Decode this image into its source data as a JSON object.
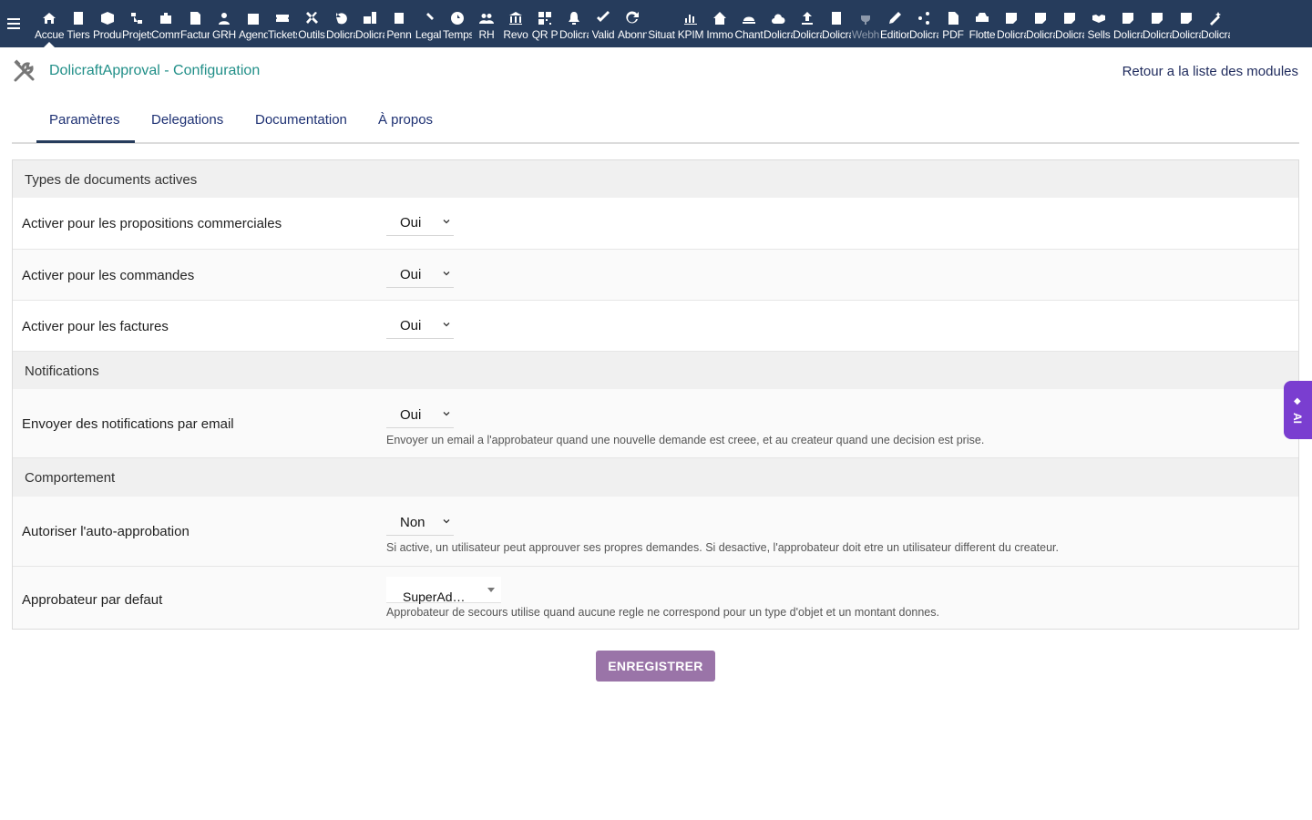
{
  "nav": {
    "items": [
      {
        "label": "Accueil",
        "icon": "home-icon"
      },
      {
        "label": "Tiers",
        "icon": "building-icon"
      },
      {
        "label": "Produits",
        "icon": "cube-icon"
      },
      {
        "label": "Projets",
        "icon": "project-icon"
      },
      {
        "label": "Commercial",
        "icon": "briefcase-icon"
      },
      {
        "label": "Facturation",
        "icon": "invoice-icon"
      },
      {
        "label": "GRH",
        "icon": "user-icon"
      },
      {
        "label": "Agenda",
        "icon": "calendar-icon"
      },
      {
        "label": "Tickets",
        "icon": "ticket-icon"
      },
      {
        "label": "Outils",
        "icon": "tools-icon"
      },
      {
        "label": "Dolicraft",
        "icon": "undo-icon"
      },
      {
        "label": "Dolicraft",
        "icon": "briefcase-doc-icon"
      },
      {
        "label": "Penn",
        "icon": "doc-icon"
      },
      {
        "label": "Legal",
        "icon": "gavel-icon"
      },
      {
        "label": "Temps",
        "icon": "clock-icon"
      },
      {
        "label": "RH",
        "icon": "users-icon"
      },
      {
        "label": "Revo",
        "icon": "bank-icon"
      },
      {
        "label": "QR P",
        "icon": "qrcode-icon"
      },
      {
        "label": "Dolicraft",
        "icon": "bell-icon"
      },
      {
        "label": "Valid",
        "icon": "check-double-icon"
      },
      {
        "label": "Abonn",
        "icon": "refresh-icon"
      },
      {
        "label": "Situat",
        "icon": "blank-icon"
      },
      {
        "label": "KPIM",
        "icon": "chart-icon"
      },
      {
        "label": "Immo",
        "icon": "house-icon"
      },
      {
        "label": "Chant",
        "icon": "hardhat-icon"
      },
      {
        "label": "Dolicraft",
        "icon": "cloud-icon"
      },
      {
        "label": "Dolicraft",
        "icon": "upload-icon"
      },
      {
        "label": "Dolicraft",
        "icon": "building-icon"
      },
      {
        "label": "Webh",
        "icon": "plug-icon",
        "dim": true
      },
      {
        "label": "Edition",
        "icon": "edit-icon"
      },
      {
        "label": "Dolicraft",
        "icon": "share-icon"
      },
      {
        "label": "PDF",
        "icon": "pdf-icon"
      },
      {
        "label": "Flotte",
        "icon": "car-icon"
      },
      {
        "label": "Dolicraft",
        "icon": "note-icon"
      },
      {
        "label": "Dolicraft",
        "icon": "note-icon"
      },
      {
        "label": "Dolicraft",
        "icon": "note-icon"
      },
      {
        "label": "Sells",
        "icon": "handshake-icon"
      },
      {
        "label": "Dolicraft",
        "icon": "note-icon"
      },
      {
        "label": "Dolicraft",
        "icon": "note-icon"
      },
      {
        "label": "Dolicraft",
        "icon": "note-icon"
      },
      {
        "label": "Dolicraft",
        "icon": "magic-icon"
      }
    ]
  },
  "header": {
    "title": "DolicraftApproval - Configuration",
    "back_link": "Retour a la liste des modules"
  },
  "tabs": [
    {
      "label": "Paramètres",
      "active": true
    },
    {
      "label": "Delegations"
    },
    {
      "label": "Documentation"
    },
    {
      "label": "À propos"
    }
  ],
  "form": {
    "sections": {
      "doc_types": "Types de documents actives",
      "notifications": "Notifications",
      "behaviour": "Comportement"
    },
    "rows": {
      "proposals": {
        "label": "Activer pour les propositions commerciales",
        "value": "Oui"
      },
      "orders": {
        "label": "Activer pour les commandes",
        "value": "Oui"
      },
      "invoices": {
        "label": "Activer pour les factures",
        "value": "Oui"
      },
      "email": {
        "label": "Envoyer des notifications par email",
        "value": "Oui",
        "help": "Envoyer un email a l'approbateur quand une nouvelle demande est creee, et au createur quand une decision est prise."
      },
      "self_approval": {
        "label": "Autoriser l'auto-approbation",
        "value": "Non",
        "help": "Si active, un utilisateur peut approuver ses propres demandes. Si desactive, l'approbateur doit etre un utilisateur different du createur."
      },
      "default_approver": {
        "label": "Approbateur par defaut",
        "value": "SuperAd…",
        "help": "Approbateur de secours utilise quand aucune regle ne correspond pour un type d'objet et un montant donnes."
      }
    }
  },
  "save_label": "ENREGISTRER",
  "ai_tab": {
    "label": "AI"
  },
  "colors": {
    "nav_bg": "#263c5c",
    "title": "#218f88",
    "save": "#9a74a8",
    "ai": "#7a3ed0"
  }
}
